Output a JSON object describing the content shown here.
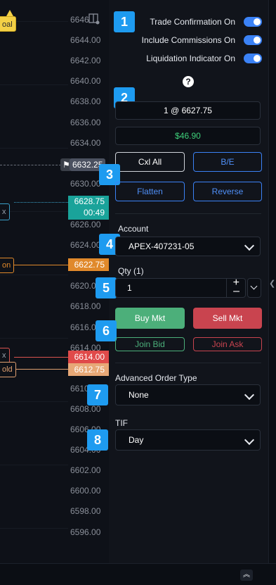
{
  "axis": {
    "ticks": [
      "6646",
      "6644.00",
      "6642.00",
      "6640.00",
      "6638.00",
      "6636.00",
      "6634.00",
      "6632.00",
      "6630.00",
      "6628.00",
      "6626.00",
      "6624.00",
      "6622.00",
      "6620.00",
      "6618.00",
      "6616.00",
      "6614.00",
      "6612.00",
      "6610.00",
      "6608.00",
      "6606.00",
      "6604.00",
      "6602.00",
      "6600.00",
      "6598.00",
      "6596.00"
    ],
    "current_price": "6632.25",
    "position_price": "6628.75",
    "position_timer": "00:49",
    "tp_price": "6622.75",
    "stop_price": "6614.00",
    "stop2_price": "6612.75"
  },
  "chart_tags": {
    "goal": "oal",
    "x1": "x",
    "tp": "on",
    "x2": "x",
    "old": "old"
  },
  "toggles": [
    {
      "label": "Trade Confirmation On",
      "on": true
    },
    {
      "label": "Include Commissions On",
      "on": true
    },
    {
      "label": "Liquidation Indicator On",
      "on": true
    }
  ],
  "help": "?",
  "badges": [
    "1",
    "2",
    "3",
    "4",
    "5",
    "6",
    "7",
    "8"
  ],
  "position": {
    "summary": "1 @ 6627.75",
    "pnl": "$46.90",
    "pnl_color": "#3ecf7a"
  },
  "actions": {
    "cxl_all": "Cxl All",
    "be": "B/E",
    "flatten": "Flatten",
    "reverse": "Reverse"
  },
  "account": {
    "label": "Account",
    "value": "APEX-407231-05"
  },
  "qty": {
    "label": "Qty (1)",
    "value": "1",
    "plus": "+",
    "minus": "–"
  },
  "orders": {
    "buy": "Buy Mkt",
    "sell": "Sell Mkt",
    "join_bid": "Join Bid",
    "join_ask": "Join Ask",
    "buy_color": "#4caf7a",
    "sell_color": "#c9444f"
  },
  "advanced": {
    "label": "Advanced Order Type",
    "value": "None"
  },
  "tif": {
    "label": "TIF",
    "value": "Day"
  }
}
